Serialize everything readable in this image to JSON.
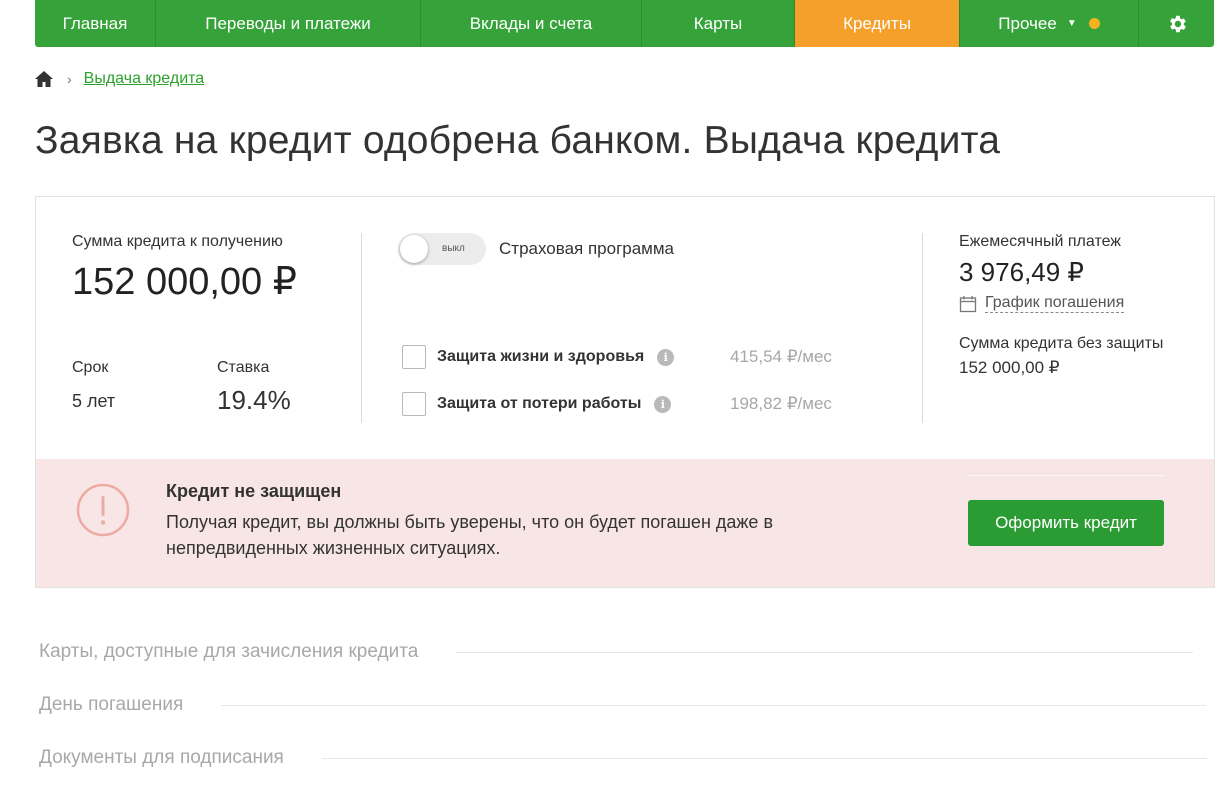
{
  "nav": {
    "items": [
      {
        "label": "Главная"
      },
      {
        "label": "Переводы и платежи"
      },
      {
        "label": "Вклады и счета"
      },
      {
        "label": "Карты"
      },
      {
        "label": "Кредиты"
      },
      {
        "label": "Прочее"
      }
    ],
    "active_index": 4,
    "settings_icon": "gear-icon",
    "colors": {
      "bar": "#36a33a",
      "active": "#f5a02a",
      "notification_dot": "#f6b21c"
    }
  },
  "breadcrumb": {
    "home_icon": "home-icon",
    "current": "Выдача кредита"
  },
  "page_title": "Заявка на кредит одобрена банком. Выдача кредита",
  "loan": {
    "amount_label": "Сумма кредита к получению",
    "amount": "152 000,00 ₽",
    "term_label": "Срок",
    "term": "5 лет",
    "rate_label": "Ставка",
    "rate": "19.4%"
  },
  "insurance": {
    "toggle_state_text": "выкл",
    "toggle_label": "Страховая программа",
    "options": [
      {
        "label": "Защита жизни и здоровья",
        "price": "415,54 ₽/мес",
        "checked": false
      },
      {
        "label": "Защита от потери работы",
        "price": "198,82 ₽/мес",
        "checked": false
      }
    ],
    "info_glyph": "i"
  },
  "summary": {
    "monthly_label": "Ежемесячный платеж",
    "monthly": "3 976,49 ₽",
    "schedule_link": "График погашения",
    "no_protection_label": "Сумма кредита без защиты",
    "no_protection": "152 000,00 ₽"
  },
  "alert": {
    "title": "Кредит не защищен",
    "text": "Получая кредит, вы должны быть уверены, что он будет погашен даже в непредвиденных жизненных ситуациях.",
    "button": "Оформить кредит",
    "icon": "exclamation-circle-icon",
    "background": "#f8e6e6"
  },
  "sections": [
    {
      "title": "Карты, доступные для зачисления кредита"
    },
    {
      "title": "День погашения"
    },
    {
      "title": "Документы для подписания"
    }
  ]
}
